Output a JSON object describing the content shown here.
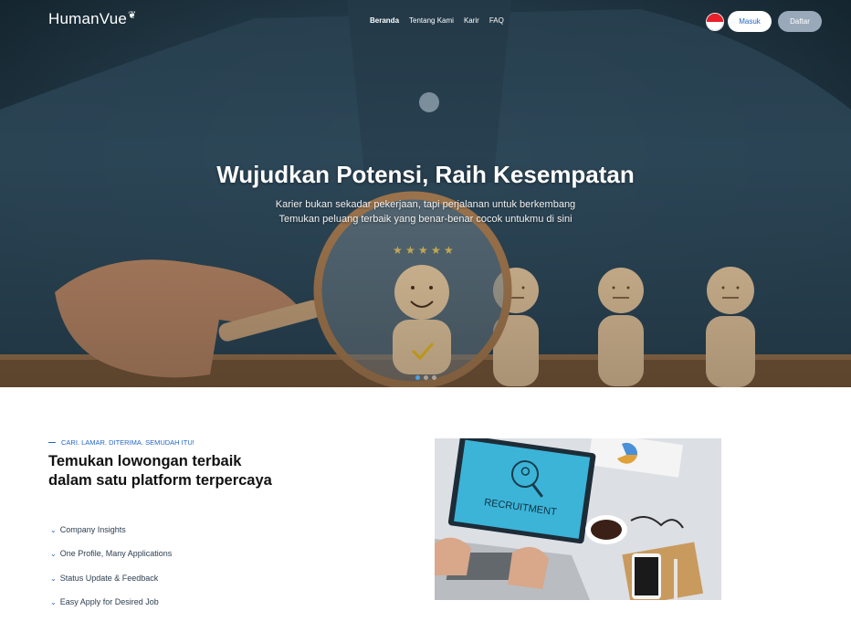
{
  "brand": {
    "logo": "HumanVue"
  },
  "nav": {
    "items": [
      {
        "label": "Beranda",
        "active": true
      },
      {
        "label": "Tentang Kami",
        "active": false
      },
      {
        "label": "Karir",
        "active": false
      },
      {
        "label": "FAQ",
        "active": false
      }
    ],
    "login_label": "Masuk",
    "register_label": "Daftar",
    "language_flag": "indonesia-flag-icon"
  },
  "hero": {
    "title": "Wujudkan Potensi, Raih Kesempatan",
    "subtitle_line1": "Karier bukan sekadar pekerjaan, tapi perjalanan untuk berkembang",
    "subtitle_line2": "Temukan peluang terbaik yang benar-benar cocok untukmu di sini",
    "slides": 3,
    "active_slide": 1
  },
  "intro": {
    "eyebrow": "CARI. LAMAR. DITERIMA. SEMUDAH ITU!",
    "headline": "Temukan lowongan terbaik dalam satu platform terpercaya",
    "features": [
      "Company Insights",
      "One Profile, Many Applications",
      "Status Update & Feedback",
      "Easy Apply for Desired Job"
    ]
  },
  "image": {
    "screen_text": "RECRUITMENT"
  },
  "colors": {
    "accent": "#2466c6",
    "register_button": "#9aa9ba",
    "hero_bg": "#26404f"
  }
}
